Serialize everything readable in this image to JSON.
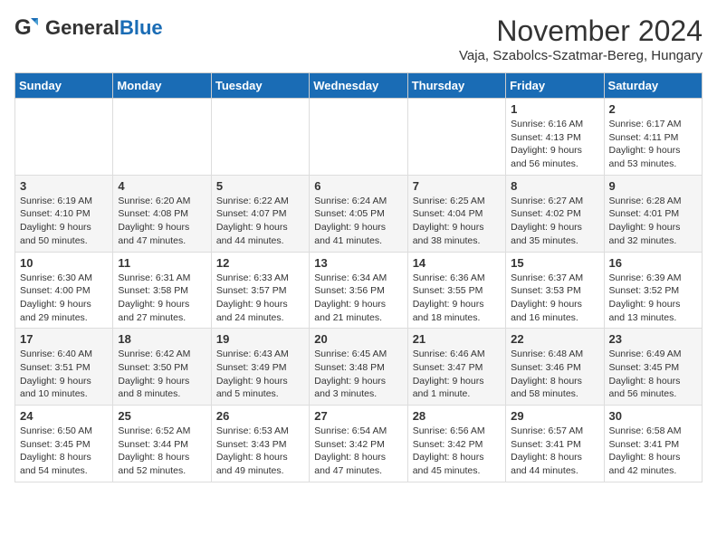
{
  "header": {
    "logo_general": "General",
    "logo_blue": "Blue",
    "month_title": "November 2024",
    "subtitle": "Vaja, Szabolcs-Szatmar-Bereg, Hungary"
  },
  "calendar": {
    "days_of_week": [
      "Sunday",
      "Monday",
      "Tuesday",
      "Wednesday",
      "Thursday",
      "Friday",
      "Saturday"
    ],
    "weeks": [
      [
        {
          "day": "",
          "info": ""
        },
        {
          "day": "",
          "info": ""
        },
        {
          "day": "",
          "info": ""
        },
        {
          "day": "",
          "info": ""
        },
        {
          "day": "",
          "info": ""
        },
        {
          "day": "1",
          "info": "Sunrise: 6:16 AM\nSunset: 4:13 PM\nDaylight: 9 hours and 56 minutes."
        },
        {
          "day": "2",
          "info": "Sunrise: 6:17 AM\nSunset: 4:11 PM\nDaylight: 9 hours and 53 minutes."
        }
      ],
      [
        {
          "day": "3",
          "info": "Sunrise: 6:19 AM\nSunset: 4:10 PM\nDaylight: 9 hours and 50 minutes."
        },
        {
          "day": "4",
          "info": "Sunrise: 6:20 AM\nSunset: 4:08 PM\nDaylight: 9 hours and 47 minutes."
        },
        {
          "day": "5",
          "info": "Sunrise: 6:22 AM\nSunset: 4:07 PM\nDaylight: 9 hours and 44 minutes."
        },
        {
          "day": "6",
          "info": "Sunrise: 6:24 AM\nSunset: 4:05 PM\nDaylight: 9 hours and 41 minutes."
        },
        {
          "day": "7",
          "info": "Sunrise: 6:25 AM\nSunset: 4:04 PM\nDaylight: 9 hours and 38 minutes."
        },
        {
          "day": "8",
          "info": "Sunrise: 6:27 AM\nSunset: 4:02 PM\nDaylight: 9 hours and 35 minutes."
        },
        {
          "day": "9",
          "info": "Sunrise: 6:28 AM\nSunset: 4:01 PM\nDaylight: 9 hours and 32 minutes."
        }
      ],
      [
        {
          "day": "10",
          "info": "Sunrise: 6:30 AM\nSunset: 4:00 PM\nDaylight: 9 hours and 29 minutes."
        },
        {
          "day": "11",
          "info": "Sunrise: 6:31 AM\nSunset: 3:58 PM\nDaylight: 9 hours and 27 minutes."
        },
        {
          "day": "12",
          "info": "Sunrise: 6:33 AM\nSunset: 3:57 PM\nDaylight: 9 hours and 24 minutes."
        },
        {
          "day": "13",
          "info": "Sunrise: 6:34 AM\nSunset: 3:56 PM\nDaylight: 9 hours and 21 minutes."
        },
        {
          "day": "14",
          "info": "Sunrise: 6:36 AM\nSunset: 3:55 PM\nDaylight: 9 hours and 18 minutes."
        },
        {
          "day": "15",
          "info": "Sunrise: 6:37 AM\nSunset: 3:53 PM\nDaylight: 9 hours and 16 minutes."
        },
        {
          "day": "16",
          "info": "Sunrise: 6:39 AM\nSunset: 3:52 PM\nDaylight: 9 hours and 13 minutes."
        }
      ],
      [
        {
          "day": "17",
          "info": "Sunrise: 6:40 AM\nSunset: 3:51 PM\nDaylight: 9 hours and 10 minutes."
        },
        {
          "day": "18",
          "info": "Sunrise: 6:42 AM\nSunset: 3:50 PM\nDaylight: 9 hours and 8 minutes."
        },
        {
          "day": "19",
          "info": "Sunrise: 6:43 AM\nSunset: 3:49 PM\nDaylight: 9 hours and 5 minutes."
        },
        {
          "day": "20",
          "info": "Sunrise: 6:45 AM\nSunset: 3:48 PM\nDaylight: 9 hours and 3 minutes."
        },
        {
          "day": "21",
          "info": "Sunrise: 6:46 AM\nSunset: 3:47 PM\nDaylight: 9 hours and 1 minute."
        },
        {
          "day": "22",
          "info": "Sunrise: 6:48 AM\nSunset: 3:46 PM\nDaylight: 8 hours and 58 minutes."
        },
        {
          "day": "23",
          "info": "Sunrise: 6:49 AM\nSunset: 3:45 PM\nDaylight: 8 hours and 56 minutes."
        }
      ],
      [
        {
          "day": "24",
          "info": "Sunrise: 6:50 AM\nSunset: 3:45 PM\nDaylight: 8 hours and 54 minutes."
        },
        {
          "day": "25",
          "info": "Sunrise: 6:52 AM\nSunset: 3:44 PM\nDaylight: 8 hours and 52 minutes."
        },
        {
          "day": "26",
          "info": "Sunrise: 6:53 AM\nSunset: 3:43 PM\nDaylight: 8 hours and 49 minutes."
        },
        {
          "day": "27",
          "info": "Sunrise: 6:54 AM\nSunset: 3:42 PM\nDaylight: 8 hours and 47 minutes."
        },
        {
          "day": "28",
          "info": "Sunrise: 6:56 AM\nSunset: 3:42 PM\nDaylight: 8 hours and 45 minutes."
        },
        {
          "day": "29",
          "info": "Sunrise: 6:57 AM\nSunset: 3:41 PM\nDaylight: 8 hours and 44 minutes."
        },
        {
          "day": "30",
          "info": "Sunrise: 6:58 AM\nSunset: 3:41 PM\nDaylight: 8 hours and 42 minutes."
        }
      ]
    ]
  }
}
